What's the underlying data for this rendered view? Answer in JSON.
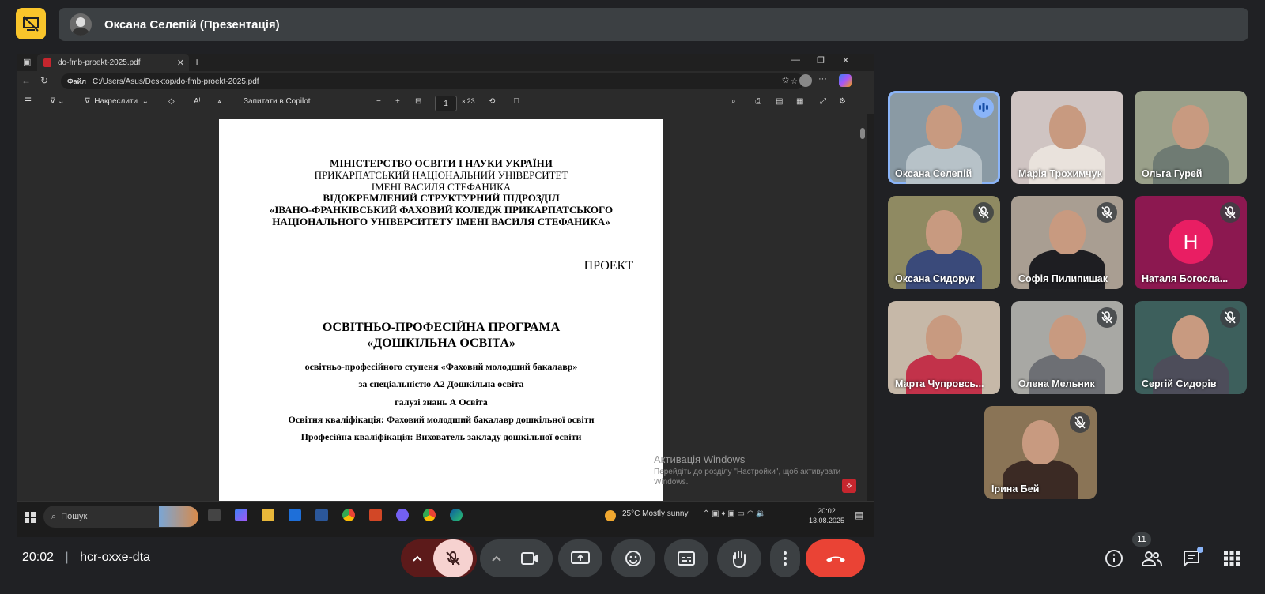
{
  "presenter": {
    "name": "Оксана Селепій (Презентація)"
  },
  "browser": {
    "tab_title": "do-fmb-proekt-2025.pdf",
    "address_prefix": "Файл",
    "address": "C:/Users/Asus/Desktop/do-fmb-proekt-2025.pdf"
  },
  "pdf_toolbar": {
    "draw_label": "Накреслити",
    "copilot_label": "Запитати в Copilot",
    "page_current": "1",
    "page_total": "з 23"
  },
  "document": {
    "lines": [
      "МІНІСТЕРСТВО ОСВІТИ І НАУКИ УКРАЇНИ",
      "ПРИКАРПАТСЬКИЙ НАЦІОНАЛЬНИЙ УНІВЕРСИТЕТ",
      "ІМЕНІ ВАСИЛЯ СТЕФАНИКА",
      "ВІДОКРЕМЛЕНИЙ СТРУКТУРНИЙ ПІДРОЗДІЛ",
      "«ІВАНО-ФРАНКІВСЬКИЙ ФАХОВИЙ КОЛЕДЖ ПРИКАРПАТСЬКОГО",
      "НАЦІОНАЛЬНОГО УНІВЕРСИТЕТУ ІМЕНІ ВАСИЛЯ СТЕФАНИКА»"
    ],
    "draft": "ПРОЕКТ",
    "title1": "ОСВІТНЬО-ПРОФЕСІЙНА ПРОГРАМА",
    "title2": "«ДОШКІЛЬНА ОСВІТА»",
    "details": [
      "освітньо-професійного ступеня «Фаховий молодший бакалавр»",
      "за  спеціальністю А2 Дошкільна освіта",
      "галузі  знань А Освіта",
      "Освітня кваліфікація: Фаховий молодший бакалавр дошкільної освіти",
      "Професійна кваліфікація: Вихователь закладу дошкільної освіти"
    ]
  },
  "watermark": {
    "title": "Активація Windows",
    "text": "Перейдіть до розділу \"Настройки\", щоб активувати Windows."
  },
  "taskbar": {
    "search": "Пошук",
    "weather": "25°C  Mostly sunny",
    "time": "20:02",
    "date": "13.08.2025"
  },
  "participants": [
    {
      "name": "Оксана Селепій",
      "state": "speaking",
      "bg": "#8a9aa4",
      "shirt": "#b7c2c8"
    },
    {
      "name": "Марія Трохимчук",
      "state": "unmuted",
      "bg": "#cfc4c2",
      "shirt": "#e9e2dc"
    },
    {
      "name": "Ольга Гурей",
      "state": "unmuted",
      "bg": "#9aa08a",
      "shirt": "#6f7b73"
    },
    {
      "name": "Оксана Сидорук",
      "state": "muted",
      "bg": "#8f8a62",
      "shirt": "#3a4a7a"
    },
    {
      "name": "Софія Пилипишак",
      "state": "muted",
      "bg": "#a99e92",
      "shirt": "#1e1e22"
    },
    {
      "name": "Наталя Богосла...",
      "state": "muted",
      "initial": "Н",
      "bg": "#8c1850"
    },
    {
      "name": "Марта Чупровсь...",
      "state": "unmuted",
      "bg": "#c6b8a8",
      "shirt": "#c2324a"
    },
    {
      "name": "Олена Мельник",
      "state": "muted",
      "bg": "#a8a8a4",
      "shirt": "#6d6f74"
    },
    {
      "name": "Сергій Сидорів",
      "state": "muted",
      "bg": "#3d5f5c",
      "shirt": "#4d4d5a"
    },
    {
      "name": "Ірина Бей",
      "state": "muted",
      "bg": "#8a7456",
      "shirt": "#3b2a24"
    }
  ],
  "meeting": {
    "time": "20:02",
    "code": "hcr-oxxe-dta",
    "people_count": "11"
  }
}
